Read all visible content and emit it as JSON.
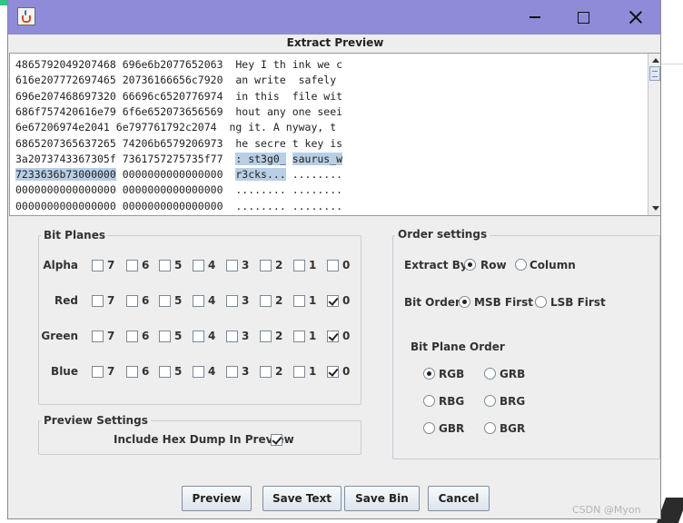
{
  "dialog": {
    "title": "Extract Preview"
  },
  "preview": {
    "lines": [
      {
        "hex1": "4865792049207468",
        "hex2": "696e6b2077652063",
        "a1": "Hey I th",
        "a2": "ink we c"
      },
      {
        "hex1": "616e207772697465",
        "hex2": "20736166656c7920",
        "a1": "an write",
        "a2": " safely "
      },
      {
        "hex1": "696e207468697320",
        "hex2": "66696c6520776974",
        "a1": "in this ",
        "a2": "file wit"
      },
      {
        "hex1": "686f757420616e79",
        "hex2": "6f6e652073656569",
        "a1": "hout any",
        "a2": "one seei"
      },
      {
        "hex1": "6e67206974e2041",
        "hex2": "6e797761792c2074",
        "a1": "ng it. A",
        "a2": "nyway, t"
      },
      {
        "hex1": "6865207365637265",
        "hex2": "74206b6579206973",
        "a1": "he secre",
        "a2": "t key is"
      },
      {
        "hex1": "3a2073743367305f",
        "hex2": "7361757275735f77",
        "a1": ": st3g0_",
        "a2": "saurus_w"
      },
      {
        "hex1": "7233636b73000000",
        "hex2": "0000000000000000",
        "a1": "r3cks...",
        "a2": "........"
      },
      {
        "hex1": "0000000000000000",
        "hex2": "0000000000000000",
        "a1": "........",
        "a2": "........"
      },
      {
        "hex1": "0000000000000000",
        "hex2": "0000000000000000",
        "a1": "........",
        "a2": "........"
      }
    ]
  },
  "bit_planes": {
    "title": "Bit Planes",
    "channels": [
      {
        "name": "Alpha",
        "checked": [
          false,
          false,
          false,
          false,
          false,
          false,
          false,
          false
        ]
      },
      {
        "name": "Red",
        "checked": [
          false,
          false,
          false,
          false,
          false,
          false,
          false,
          true
        ]
      },
      {
        "name": "Green",
        "checked": [
          false,
          false,
          false,
          false,
          false,
          false,
          false,
          true
        ]
      },
      {
        "name": "Blue",
        "checked": [
          false,
          false,
          false,
          false,
          false,
          false,
          false,
          true
        ]
      }
    ],
    "bits": [
      "7",
      "6",
      "5",
      "4",
      "3",
      "2",
      "1",
      "0"
    ]
  },
  "preview_settings": {
    "title": "Preview Settings",
    "hex_dump_label": "Include Hex Dump In Preview",
    "hex_dump_checked": true
  },
  "order_settings": {
    "title": "Order settings",
    "extract_by_label": "Extract By",
    "extract_by_options": [
      "Row",
      "Column"
    ],
    "extract_by_selected": "Row",
    "bit_order_label": "Bit Order",
    "bit_order_options": [
      "MSB First",
      "LSB First"
    ],
    "bit_order_selected": "MSB First",
    "plane_order_label": "Bit Plane Order",
    "plane_order_options": [
      "RGB",
      "GRB",
      "RBG",
      "BRG",
      "GBR",
      "BGR"
    ],
    "plane_order_selected": "RGB"
  },
  "buttons": {
    "preview": "Preview",
    "save_text": "Save Text",
    "save_bin": "Save Bin",
    "cancel": "Cancel"
  },
  "watermark": "CSDN @Myon"
}
